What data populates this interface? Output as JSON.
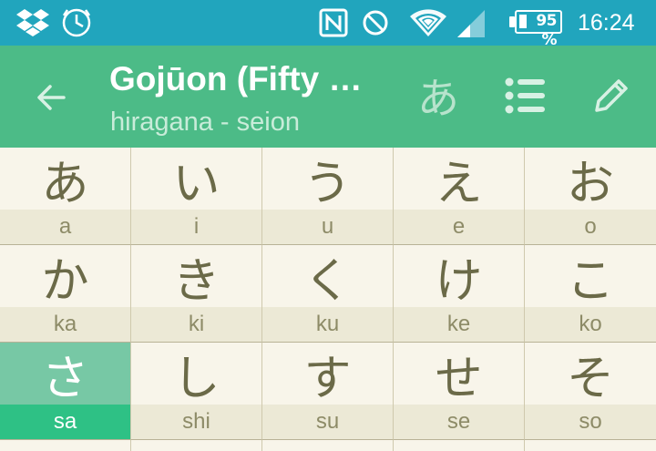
{
  "status_bar": {
    "icons": [
      "dropbox-icon",
      "clock-sync-icon",
      "nfc-icon",
      "do-not-disturb-icon",
      "wifi-icon",
      "signal-icon"
    ],
    "battery": "95 %",
    "time": "16:24"
  },
  "app_bar": {
    "title": "Gojūon (Fifty Sounds)",
    "subtitle": "hiragana - seion",
    "script_toggle": "あ",
    "icons": [
      "back-arrow-icon",
      "list-icon",
      "pencil-icon"
    ]
  },
  "grid": {
    "rows": [
      [
        {
          "kana": "あ",
          "romaji": "a"
        },
        {
          "kana": "い",
          "romaji": "i"
        },
        {
          "kana": "う",
          "romaji": "u"
        },
        {
          "kana": "え",
          "romaji": "e"
        },
        {
          "kana": "お",
          "romaji": "o"
        }
      ],
      [
        {
          "kana": "か",
          "romaji": "ka"
        },
        {
          "kana": "き",
          "romaji": "ki"
        },
        {
          "kana": "く",
          "romaji": "ku"
        },
        {
          "kana": "け",
          "romaji": "ke"
        },
        {
          "kana": "こ",
          "romaji": "ko"
        }
      ],
      [
        {
          "kana": "さ",
          "romaji": "sa"
        },
        {
          "kana": "し",
          "romaji": "shi"
        },
        {
          "kana": "す",
          "romaji": "su"
        },
        {
          "kana": "せ",
          "romaji": "se"
        },
        {
          "kana": "そ",
          "romaji": "so"
        }
      ]
    ],
    "selected": "さ"
  },
  "colors": {
    "status_bar": "#21a5bd",
    "app_bar": "#4cbb87",
    "selected_kana_bg": "#77c8a5",
    "selected_romaji_bg": "#2ec185",
    "kana_text": "#6b6a48"
  }
}
